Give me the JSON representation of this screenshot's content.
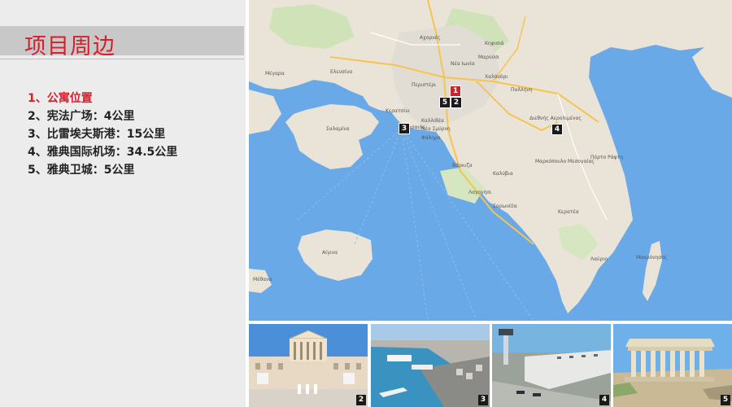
{
  "section_title": "项目周边",
  "poi_list": [
    {
      "label": "1、公寓位置",
      "active": true
    },
    {
      "label": "2、宪法广场：4公里",
      "active": false
    },
    {
      "label": "3、比雷埃夫斯港：15公里",
      "active": false
    },
    {
      "label": "4、雅典国际机场：34.5公里",
      "active": false
    },
    {
      "label": "5、雅典卫城：5公里",
      "active": false
    }
  ],
  "map": {
    "markers": [
      {
        "num": "1",
        "color": "#d3202d"
      },
      {
        "num": "5",
        "color": "#1a1a1a"
      },
      {
        "num": "2",
        "color": "#1a1a1a"
      },
      {
        "num": "3",
        "color": "#1a1a1a"
      },
      {
        "num": "4",
        "color": "#1a1a1a"
      }
    ],
    "place_labels": [
      "Αχαρνές",
      "Κηφισιά",
      "Μαρούσι",
      "Νέα Ιωνία",
      "Περιστέρι",
      "Χαλάνδρι",
      "Παλλήνη",
      "Κερατσίνι",
      "Πειραιάς",
      "Καλλιθέα",
      "Νέα Σμύρνη",
      "Φάληρο",
      "Διεθνής Αερολιμένας",
      "Μαρκόπουλο Μεσογαίας",
      "Καλύβια",
      "Λαγονήσι",
      "Σαρωνίδα",
      "Κερατέα",
      "Σαλαμίνα",
      "Αίγινα",
      "Μέθανα",
      "Ελευσίνα",
      "Μέγαρα",
      "Βάρκιζα",
      "Πόρτο Ράφτη",
      "Λαύριο",
      "Μακρόνησος"
    ]
  },
  "photos": [
    {
      "num": "2",
      "subject": "parliament"
    },
    {
      "num": "3",
      "subject": "port"
    },
    {
      "num": "4",
      "subject": "airport"
    },
    {
      "num": "5",
      "subject": "acropolis"
    }
  ]
}
